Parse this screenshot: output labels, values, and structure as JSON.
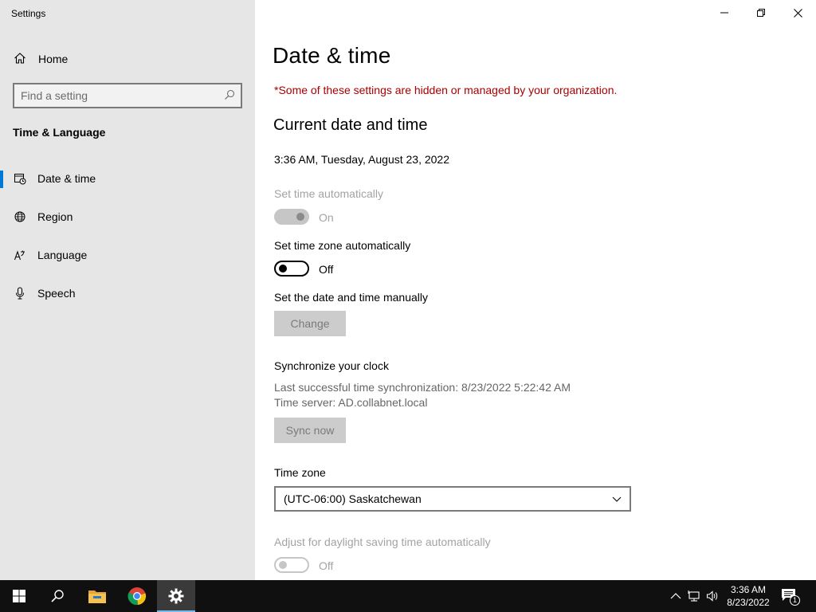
{
  "window": {
    "title": "Settings"
  },
  "sidebar": {
    "home_label": "Home",
    "search_placeholder": "Find a setting",
    "section_title": "Time & Language",
    "items": [
      {
        "label": "Date & time",
        "icon": "calendar-clock-icon",
        "active": true
      },
      {
        "label": "Region",
        "icon": "globe-icon",
        "active": false
      },
      {
        "label": "Language",
        "icon": "language-icon",
        "active": false
      },
      {
        "label": "Speech",
        "icon": "microphone-icon",
        "active": false
      }
    ]
  },
  "main": {
    "title": "Date & time",
    "managed_warning": "*Some of these settings are hidden or managed by your organization.",
    "current_heading": "Current date and time",
    "current_datetime": "3:36 AM, Tuesday, August 23, 2022",
    "set_time_auto": {
      "label": "Set time automatically",
      "state": "On",
      "enabled": false
    },
    "set_timezone_auto": {
      "label": "Set time zone automatically",
      "state": "Off",
      "enabled": true
    },
    "manual": {
      "label": "Set the date and time manually",
      "button": "Change"
    },
    "sync": {
      "heading": "Synchronize your clock",
      "last_sync": "Last successful time synchronization: 8/23/2022 5:22:42 AM",
      "server": "Time server: AD.collabnet.local",
      "button": "Sync now"
    },
    "timezone": {
      "label": "Time zone",
      "value": "(UTC-06:00) Saskatchewan"
    },
    "dst": {
      "label": "Adjust for daylight saving time automatically",
      "state": "Off",
      "enabled": false
    }
  },
  "taskbar": {
    "time": "3:36 AM",
    "date": "8/23/2022",
    "notification_count": "1",
    "apps": [
      "start-icon",
      "search-icon",
      "file-explorer-icon",
      "chrome-icon",
      "settings-icon"
    ]
  },
  "colors": {
    "accent": "#0078d7",
    "warning": "#a80000",
    "sidebar_bg": "#e6e6e6",
    "taskbar_bg": "#101010"
  }
}
